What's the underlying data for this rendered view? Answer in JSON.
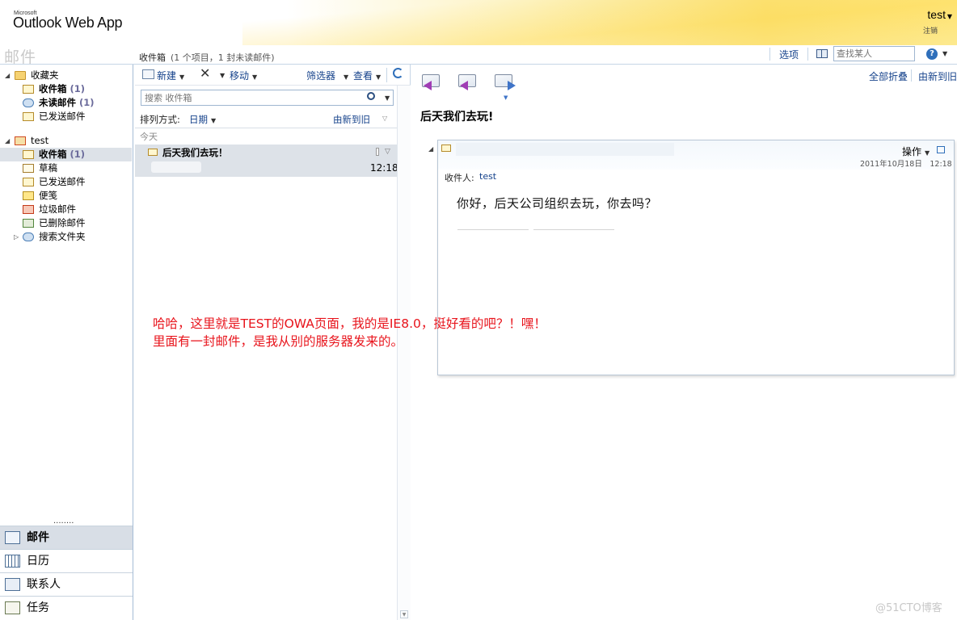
{
  "header": {
    "brand_small": "Microsoft",
    "app_name": "Outlook Web App",
    "user_name": "test",
    "sign_out": "注销"
  },
  "topbar": {
    "section_title": "邮件",
    "folder_name": "收件箱",
    "folder_count": "(1 个项目，1 封未读邮件)",
    "options_label": "选项",
    "find_placeholder": "查找某人",
    "help_label": "?"
  },
  "nav": {
    "favorites": {
      "label": "收藏夹",
      "items": [
        {
          "label": "收件箱",
          "count": "(1)",
          "bold": true
        },
        {
          "label": "未读邮件",
          "count": "(1)",
          "bold": true
        },
        {
          "label": "已发送邮件",
          "count": "",
          "bold": false
        }
      ]
    },
    "mailbox": {
      "label": "test",
      "items": [
        {
          "label": "收件箱",
          "count": "(1)",
          "bold": true
        },
        {
          "label": "草稿",
          "count": "",
          "bold": false
        },
        {
          "label": "已发送邮件",
          "count": "",
          "bold": false
        },
        {
          "label": "便笺",
          "count": "",
          "bold": false
        },
        {
          "label": "垃圾邮件",
          "count": "",
          "bold": false
        },
        {
          "label": "已删除邮件",
          "count": "",
          "bold": false
        },
        {
          "label": "搜索文件夹",
          "count": "",
          "bold": false
        }
      ]
    },
    "dots": "........",
    "modules": [
      {
        "label": "邮件",
        "icon": "mail-icon",
        "selected": true
      },
      {
        "label": "日历",
        "icon": "calendar-icon",
        "selected": false
      },
      {
        "label": "联系人",
        "icon": "contacts-icon",
        "selected": false
      },
      {
        "label": "任务",
        "icon": "tasks-icon",
        "selected": false
      }
    ]
  },
  "list": {
    "toolbar": {
      "new_label": "新建",
      "move_label": "移动",
      "filter_label": "筛选器",
      "view_label": "查看"
    },
    "search_placeholder": "搜索 收件箱",
    "sort_label": "排列方式:",
    "sort_field": "日期",
    "sort_order": "由新到旧",
    "group_label": "今天",
    "messages": [
      {
        "subject": "后天我们去玩！",
        "time": "12:18"
      }
    ]
  },
  "reading": {
    "collapse_all": "全部折叠",
    "newest_first": "由新到旧",
    "subject": "后天我们去玩!",
    "actions_label": "操作",
    "date": "2011年10月18日　12:18",
    "to_label": "收件人:",
    "to_value": "test",
    "body": "你好，后天公司组织去玩，你去吗？"
  },
  "annotation": {
    "line1": "哈哈，这里就是TEST的OWA页面，我的是IE8.0，挺好看的吧？！嘿！",
    "line2": "里面有一封邮件，是我从别的服务器发来的。"
  },
  "watermark": "@51CTO博客"
}
